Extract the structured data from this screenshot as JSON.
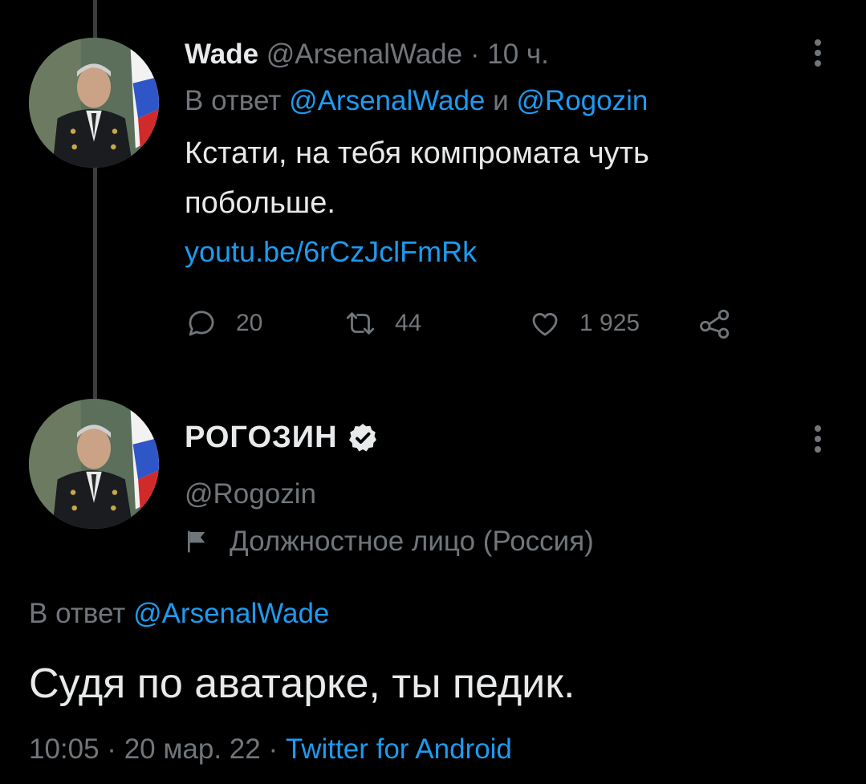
{
  "tweet1": {
    "name": "Wade",
    "handle": "@ArsenalWade",
    "sep": " · ",
    "time": "10 ч.",
    "reply_prefix": "В ответ ",
    "reply_user1": "@ArsenalWade",
    "reply_and": " и ",
    "reply_user2": "@Rogozin",
    "text_line1": "Кстати, на тебя компромата чуть",
    "text_line2": "побольше.",
    "link": "youtu.be/6rCzJclFmRk",
    "replies": "20",
    "retweets": "44",
    "likes": "1 925",
    "avatar_icon": "profile-photo"
  },
  "tweet2": {
    "name": "РОГОЗИН",
    "verified_icon": "verified-badge-icon",
    "handle": "@Rogozin",
    "label_icon": "flag-icon",
    "label": "Должностное лицо (Россия)",
    "reply_prefix": "В ответ ",
    "reply_user": "@ArsenalWade",
    "text": "Судя по аватарке, ты педик.",
    "timestamp": "10:05 · 20 мар. 22 · ",
    "source": "Twitter for Android"
  },
  "colors": {
    "background": "#000000",
    "text": "#e7e9ea",
    "muted": "#71767b",
    "link": "#1d9bf0",
    "thread_line": "#3a3d41"
  }
}
